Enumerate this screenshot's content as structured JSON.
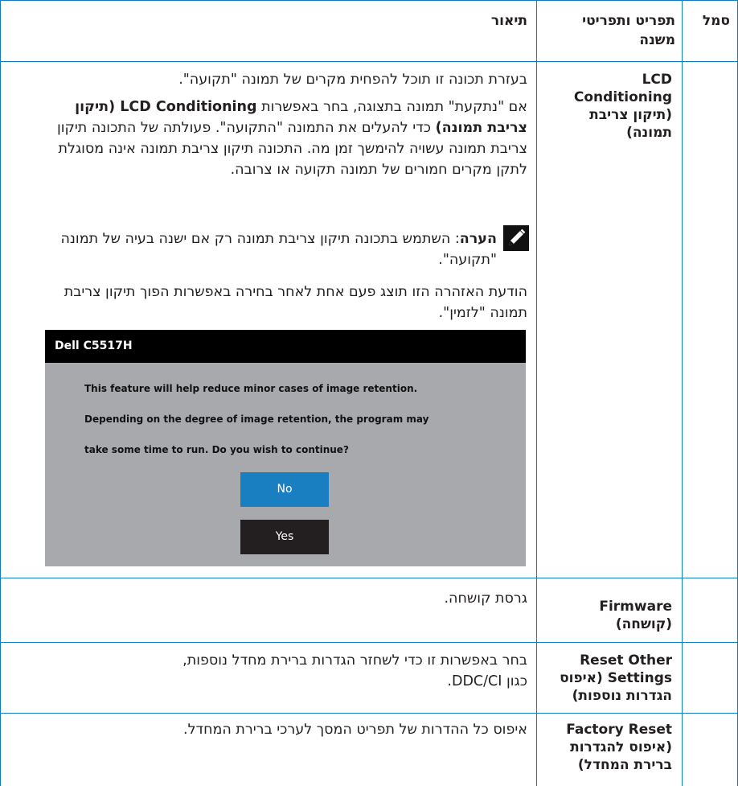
{
  "header": {
    "symbol": "סמל",
    "menu": "תפריט ותפריטי משנה",
    "description": "תיאור"
  },
  "rows": [
    {
      "name": "LCD Conditioning (תיקון צריבת תמונה)",
      "para1": "בעזרת תכונה זו תוכל להפחית מקרים של תמונה \"תקועה\".",
      "para2_a": "אם \"נתקעת\" תמונה בתצוגה, בחר באפשרות ",
      "para2_b": "LCD Conditioning (תיקון צריבת תמונה)",
      "para2_c": " כדי להעלים את התמונה \"התקועה\". פעולתה של התכונה תיקון צריבת תמונה עשויה להימשך זמן מה. התכונה תיקון צריבת תמונה אינה מסוגלת לתקן מקרים חמורים של תמונה תקועה או צרובה.",
      "note_label": "הערה",
      "note_text": ": השתמש בתכונה תיקון צריבת תמונה רק אם ישנה בעיה של תמונה \"תקועה\".",
      "para3": "הודעת האזהרה הזו תוצג פעם אחת לאחר בחירה באפשרות הפוך תיקון צריבת תמונה \"לזמין\"."
    },
    {
      "name": "Firmware (קושחה)",
      "desc": "גרסת קושחה."
    },
    {
      "name": "Reset Other Settings (איפוס הגדרות נוספות)",
      "desc": "בחר באפשרות זו כדי לשחזר הגדרות ברירת מחדל נוספות, כגון DDC/CI."
    },
    {
      "name": "Factory Reset (איפוס להגדרות ברירת המחדל)",
      "desc": "איפוס כל ההדרות של תפריט המסך לערכי ברירת המחדל."
    }
  ],
  "dialog": {
    "title": "Dell C5517H",
    "line1": "This feature will help reduce minor cases of image retention.",
    "line2": "Depending on the degree of image retention, the program may",
    "line3": "take some time to run. Do you wish to continue?",
    "no_label": "No",
    "yes_label": "Yes",
    "button_color": "#1a7fc1",
    "button_dark_color": "#231f20"
  },
  "colors": {
    "rule": "#0b7cc0",
    "text": "#231f20"
  }
}
